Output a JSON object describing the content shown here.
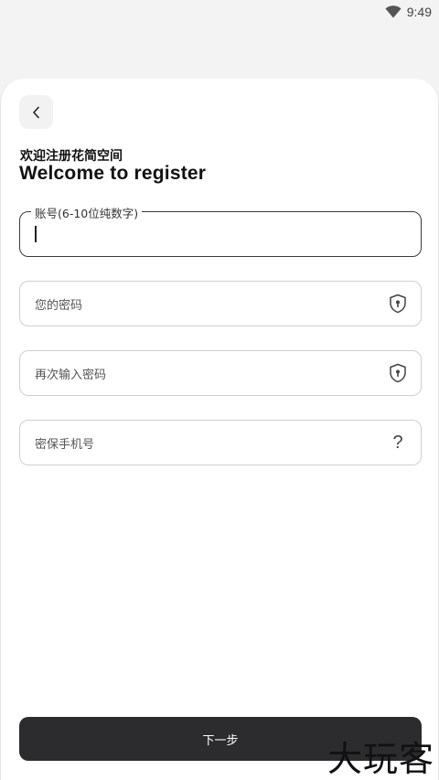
{
  "status_bar": {
    "time": "9:49",
    "wifi_icon": "wifi-icon"
  },
  "header": {
    "back_icon": "chevron-left-icon",
    "title_cn": "欢迎注册花简空间",
    "title_en": "Welcome to register"
  },
  "form": {
    "account": {
      "label": "账号(6-10位纯数字)",
      "value": ""
    },
    "password": {
      "placeholder": "您的密码",
      "icon": "shield-lock-icon"
    },
    "password_confirm": {
      "placeholder": "再次输入密码",
      "icon": "shield-lock-icon"
    },
    "security_phone": {
      "placeholder": "密保手机号",
      "icon": "question-icon",
      "icon_glyph": "?"
    }
  },
  "actions": {
    "next_label": "下一步"
  },
  "watermark": "大玩客",
  "colors": {
    "button_bg": "#2c2c2e",
    "sheet_bg": "#ffffff",
    "page_bg": "#f3f3f3"
  }
}
